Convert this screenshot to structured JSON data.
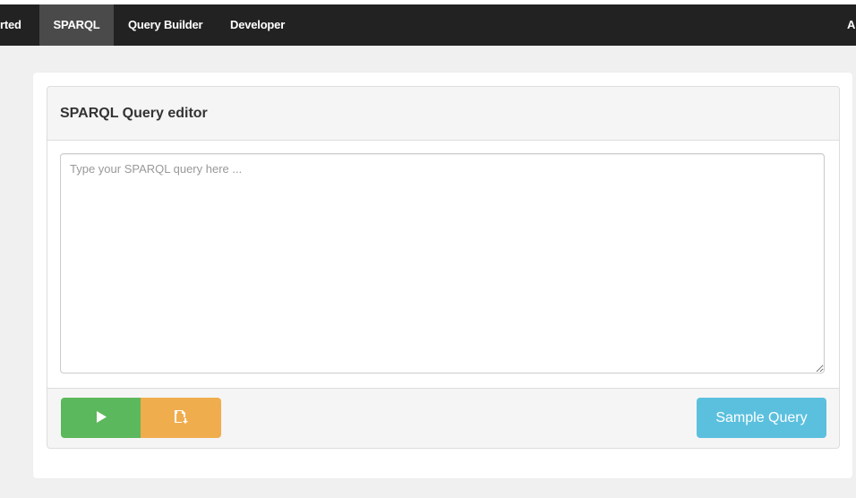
{
  "navbar": {
    "items": [
      {
        "label": "rted"
      },
      {
        "label": "SPARQL",
        "active": true
      },
      {
        "label": "Query Builder"
      },
      {
        "label": "Developer"
      },
      {
        "label": "A"
      }
    ]
  },
  "editor": {
    "title": "SPARQL Query editor",
    "query_value": "",
    "query_placeholder": "Type your SPARQL query here ..."
  },
  "actions": {
    "run_icon": "play-icon",
    "save_icon": "save-icon",
    "sample_label": "Sample Query"
  },
  "colors": {
    "navbar_bg": "#222222",
    "nav_active_bg": "#4a4a4a",
    "run_button": "#5cb85c",
    "save_button": "#f0ad4e",
    "sample_button": "#5bc0de",
    "panel_bg": "#f5f5f5"
  }
}
